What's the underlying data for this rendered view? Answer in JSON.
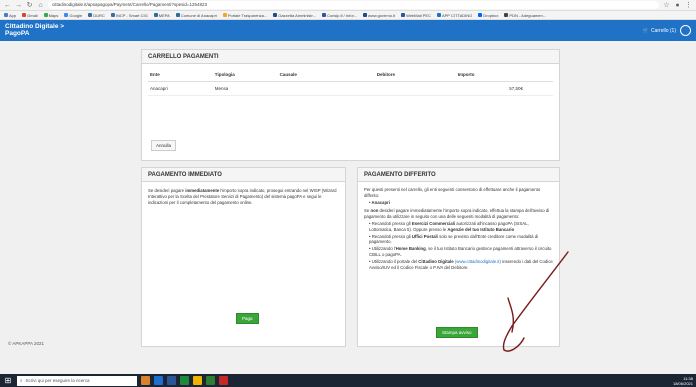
{
  "browser": {
    "url": "cittadinodigitale.it/apsapagopa/Payment/Carrello/Pagamenti?spesid=1254823",
    "bookmarks": [
      {
        "label": "App",
        "color": "#4a7ec2"
      },
      {
        "label": "Gmail",
        "color": "#d44638"
      },
      {
        "label": "Maps",
        "color": "#34a853"
      },
      {
        "label": "Google",
        "color": "#4285f4"
      },
      {
        "label": "DURC",
        "color": "#3a6ea5"
      },
      {
        "label": "INCP - Smart CIG",
        "color": "#3a6ea5"
      },
      {
        "label": "MEPA",
        "color": "#2c6e9b"
      },
      {
        "label": "Comune di Anacapri",
        "color": "#2c6e9b"
      },
      {
        "label": "Portale Trasparenza...",
        "color": "#f5a623"
      },
      {
        "label": "Gazzetta Amministr...",
        "color": "#1f4d8a"
      },
      {
        "label": "Consip.it / Infor...",
        "color": "#2b579a"
      },
      {
        "label": "www.governo.it",
        "color": "#1f4d8a"
      },
      {
        "label": "WebMail PEC",
        "color": "#2b579a"
      },
      {
        "label": "APP CITTADINO",
        "color": "#1f72c5"
      },
      {
        "label": "Dropbox",
        "color": "#0061ff"
      },
      {
        "label": "PDN - Adeguamen...",
        "color": "#444444"
      }
    ]
  },
  "header": {
    "title_line1": "Cittadino Digitale >",
    "title_line2": "PagoPA",
    "cart_label": "Carrello (1)"
  },
  "cart": {
    "title": "CARRELLO PAGAMENTI",
    "columns": [
      "Ente",
      "Tipologia",
      "Causale",
      "Debitore",
      "Importo"
    ],
    "rows": [
      {
        "ente": "Anacapri",
        "tipologia": "Mensa",
        "causale": "",
        "debitore": "",
        "importo": "57,50€"
      }
    ],
    "cancel_button": "Annulla"
  },
  "immediate": {
    "title": "PAGAMENTO IMMEDIATO",
    "text_pre": "Se desideri pagare ",
    "text_bold": "immediatamente",
    "text_post": " l'importo sopra indicato, prosegui entrando nel WISP (Wizard Interattivo per la Scelta del Prestatore Servizi di Pagamento) del sistema pagoPA e segui le indicazioni per il completamento del pagamento online.",
    "pay_button": "Paga"
  },
  "deferred": {
    "title": "PAGAMENTO DIFFERITO",
    "intro": "Per questi presenti nel carrello, gli enti seguenti consentono di effettuare anche il pagamento differito:",
    "entity": "Anacapri",
    "p2_pre": "Se ",
    "p2_bold": "non",
    "p2_post": " desideri pagare immediatamente l'importo sopra indicato, effettua la stampa dell'avviso di pagamento da utilizzare in seguito con una delle seguenti modalità di pagamento:",
    "b1_pre": "Recandoti presso gli ",
    "b1_bold": "Esercizi Commerciali",
    "b1_mid": " autorizzati all'incasso pagoPA (SISAL, Lottomatica, Banca 5). Oppure presso le ",
    "b1_bold2": "Agenzie del tuo Istituto Bancario",
    "b2_pre": "Recandoti presso gli ",
    "b2_bold": "Uffici Postali",
    "b2_post": " solo se previsto dall'Ente creditore come modalità di pagamento.",
    "b3_pre": "Utilizzando l'",
    "b3_bold": "Home Banking",
    "b3_post": ", se il tuo Istituto Bancario gestisce pagamenti attraverso il circuito CBILL o pagoPA.",
    "b4_pre": "Utilizzando il portale del ",
    "b4_bold": "Cittadino Digitale",
    "b4_link": " (www.cittadinodigitale.it)",
    "b4_post": " inserendo i dati del Codice Avviso/IUV ed il Codice Fiscale o P.IVA del Debitore.",
    "print_button": "Stampa avviso"
  },
  "footer": {
    "copyright": "© APKAPPA 2021"
  },
  "taskbar": {
    "search_placeholder": "Scrivi qui per eseguire la ricerca",
    "time": "11:38",
    "date": "18/06/2021",
    "app_colors": [
      "#d9822b",
      "#1e6fd0",
      "#2b579a",
      "#1d8a3a",
      "#f0b400",
      "#2e7d32",
      "#c62828"
    ]
  }
}
